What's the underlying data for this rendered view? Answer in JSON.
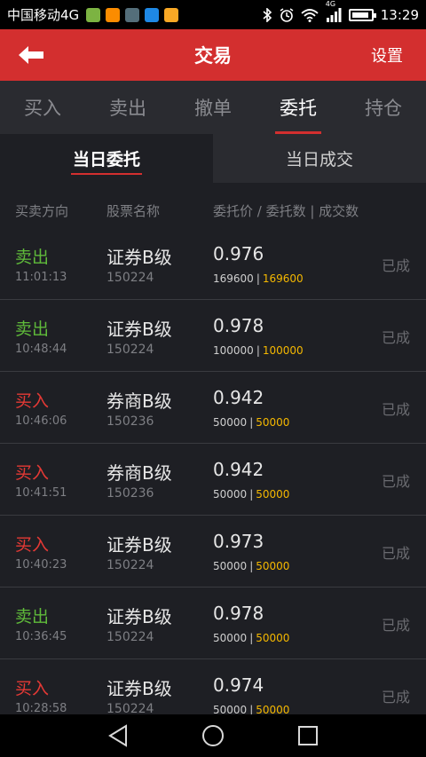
{
  "status_bar": {
    "carrier": "中国移动4G",
    "network": "4G",
    "time": "13:29",
    "app_icons": [
      {
        "name": "wechat-icon",
        "color": "#7cb342"
      },
      {
        "name": "gift-icon",
        "color": "#fb8c00"
      },
      {
        "name": "browser-icon",
        "color": "#546e7a"
      },
      {
        "name": "calendar-icon",
        "color": "#1e88e5"
      },
      {
        "name": "wallet-icon",
        "color": "#f9a825"
      }
    ]
  },
  "header": {
    "title": "交易",
    "settings_label": "设置",
    "bg_color": "#d32f2f"
  },
  "main_tabs": [
    {
      "label": "买入",
      "active": false
    },
    {
      "label": "卖出",
      "active": false
    },
    {
      "label": "撤单",
      "active": false
    },
    {
      "label": "委托",
      "active": true
    },
    {
      "label": "持仓",
      "active": false
    }
  ],
  "sub_tabs": [
    {
      "label": "当日委托",
      "active": true
    },
    {
      "label": "当日成交",
      "active": false
    }
  ],
  "columns": {
    "direction": "买卖方向",
    "stock": "股票名称",
    "price_qty": "委托价 / 委托数 | 成交数"
  },
  "orders": [
    {
      "direction": "卖出",
      "type": "sell",
      "time": "11:01:13",
      "name": "证券B级",
      "code": "150224",
      "price": "0.976",
      "qty": "169600",
      "filled": "169600",
      "status": "已成"
    },
    {
      "direction": "卖出",
      "type": "sell",
      "time": "10:48:44",
      "name": "证券B级",
      "code": "150224",
      "price": "0.978",
      "qty": "100000",
      "filled": "100000",
      "status": "已成"
    },
    {
      "direction": "买入",
      "type": "buy",
      "time": "10:46:06",
      "name": "券商B级",
      "code": "150236",
      "price": "0.942",
      "qty": "50000",
      "filled": "50000",
      "status": "已成"
    },
    {
      "direction": "买入",
      "type": "buy",
      "time": "10:41:51",
      "name": "券商B级",
      "code": "150236",
      "price": "0.942",
      "qty": "50000",
      "filled": "50000",
      "status": "已成"
    },
    {
      "direction": "买入",
      "type": "buy",
      "time": "10:40:23",
      "name": "证券B级",
      "code": "150224",
      "price": "0.973",
      "qty": "50000",
      "filled": "50000",
      "status": "已成"
    },
    {
      "direction": "卖出",
      "type": "sell",
      "time": "10:36:45",
      "name": "证券B级",
      "code": "150224",
      "price": "0.978",
      "qty": "50000",
      "filled": "50000",
      "status": "已成"
    },
    {
      "direction": "买入",
      "type": "buy",
      "time": "10:28:58",
      "name": "证券B级",
      "code": "150224",
      "price": "0.974",
      "qty": "50000",
      "filled": "50000",
      "status": "已成"
    }
  ],
  "colors": {
    "sell": "#5fba3a",
    "buy": "#e53935",
    "filled": "#f5b800"
  }
}
